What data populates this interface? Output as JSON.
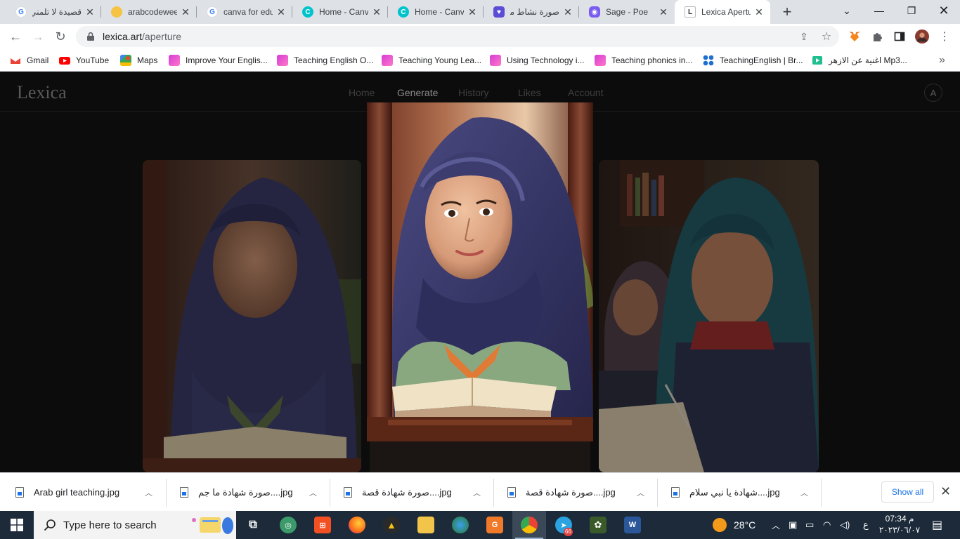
{
  "browser": {
    "tabs": [
      {
        "title": "قصيدة لا تلمني",
        "icon": "google-icon"
      },
      {
        "title": "arabcodeweek",
        "icon": "arabcodeweek-icon"
      },
      {
        "title": "canva for edu",
        "icon": "google-icon"
      },
      {
        "title": "Home - Canva",
        "icon": "canva-icon"
      },
      {
        "title": "Home - Canva",
        "icon": "canva-icon"
      },
      {
        "title": "صورة نشاط ما",
        "icon": "heart-chat-icon"
      },
      {
        "title": "Sage - Poe",
        "icon": "poe-icon"
      },
      {
        "title": "Lexica Aperture",
        "icon": "lexica-icon",
        "active": true
      }
    ],
    "new_tab_label": "+",
    "url_host": "lexica.art",
    "url_path": "/aperture",
    "bookmarks": [
      {
        "label": "Gmail",
        "icon": "gmail-icon"
      },
      {
        "label": "YouTube",
        "icon": "youtube-icon"
      },
      {
        "label": "Maps",
        "icon": "maps-icon"
      },
      {
        "label": "Improve Your Englis...",
        "icon": "bookmark-site-icon"
      },
      {
        "label": "Teaching English O...",
        "icon": "bookmark-site-icon"
      },
      {
        "label": "Teaching Young Lea...",
        "icon": "bookmark-site-icon"
      },
      {
        "label": "Using Technology i...",
        "icon": "bookmark-site-icon"
      },
      {
        "label": "Teaching phonics in...",
        "icon": "bookmark-site-icon"
      },
      {
        "label": "TeachingEnglish | Br...",
        "icon": "british-council-icon"
      },
      {
        "label": "اغنية عن الازهر Mp3...",
        "icon": "music-icon"
      }
    ],
    "bookmarks_overflow": "»"
  },
  "lexica": {
    "logo": "Lexica",
    "nav": [
      "Home",
      "Generate",
      "History",
      "Likes",
      "Account"
    ],
    "active_nav": "Generate",
    "avatar_letter": "A"
  },
  "downloads": {
    "items": [
      "Arab girl teaching.jpg",
      "صورة شهادة ما جم....jpg",
      "صورة شهادة قصة....jpg",
      "صورة شهادة قصة....jpg",
      "شهادة يا نبي سلام....jpg"
    ],
    "show_all": "Show all"
  },
  "taskbar": {
    "search_placeholder": "Type here to search",
    "weather": "28°C",
    "language": "ع",
    "time": "07:34 م",
    "date": "٢٠٢٣/٠٦/٠٧",
    "telegram_badge": "66"
  },
  "colors": {
    "chrome_tabstrip": "#dee1e6",
    "page_bg": "#0c0c0c",
    "hijab_navy": "#3b3a6b",
    "hijab_teal": "#1f5b63",
    "taskbar": "#1c2a3a",
    "link_blue": "#1a73e8"
  }
}
